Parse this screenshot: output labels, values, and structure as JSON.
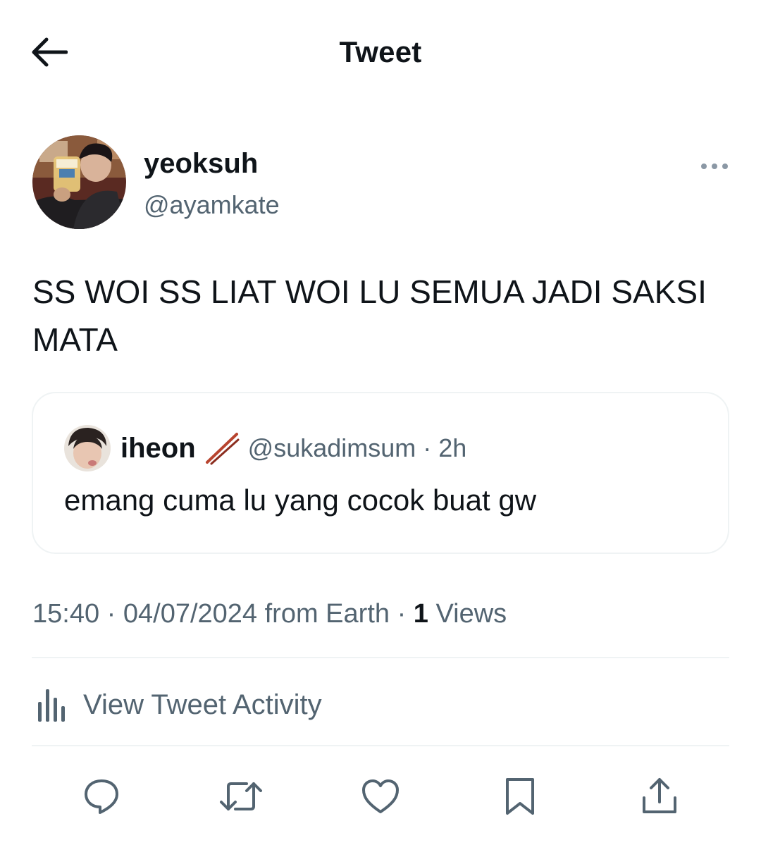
{
  "header": {
    "title": "Tweet",
    "back_icon": "arrow-left-icon"
  },
  "tweet": {
    "author": {
      "display_name": "yeoksuh",
      "handle": "@ayamkate"
    },
    "text": "SS WOI SS LIAT WOI LU SEMUA JADI SAKSI MATA",
    "quoted": {
      "display_name": "iheon",
      "emoji": "chopsticks-icon",
      "handle": "@sukadimsum",
      "separator": "·",
      "time": "2h",
      "text": "emang cuma lu yang cocok buat gw"
    },
    "meta": {
      "time": "15:40",
      "sep1": "·",
      "date": "04/07/2024",
      "source": "from Earth",
      "sep2": "·",
      "views_count": "1",
      "views_label": "Views"
    },
    "activity": {
      "label": "View Tweet Activity",
      "icon": "bar-chart-icon"
    },
    "actions": [
      "reply-icon",
      "retweet-icon",
      "like-icon",
      "bookmark-icon",
      "share-icon"
    ]
  },
  "colors": {
    "text_primary": "#0f1419",
    "text_secondary": "#536471",
    "border": "#eff3f4",
    "icon": "#536471"
  }
}
